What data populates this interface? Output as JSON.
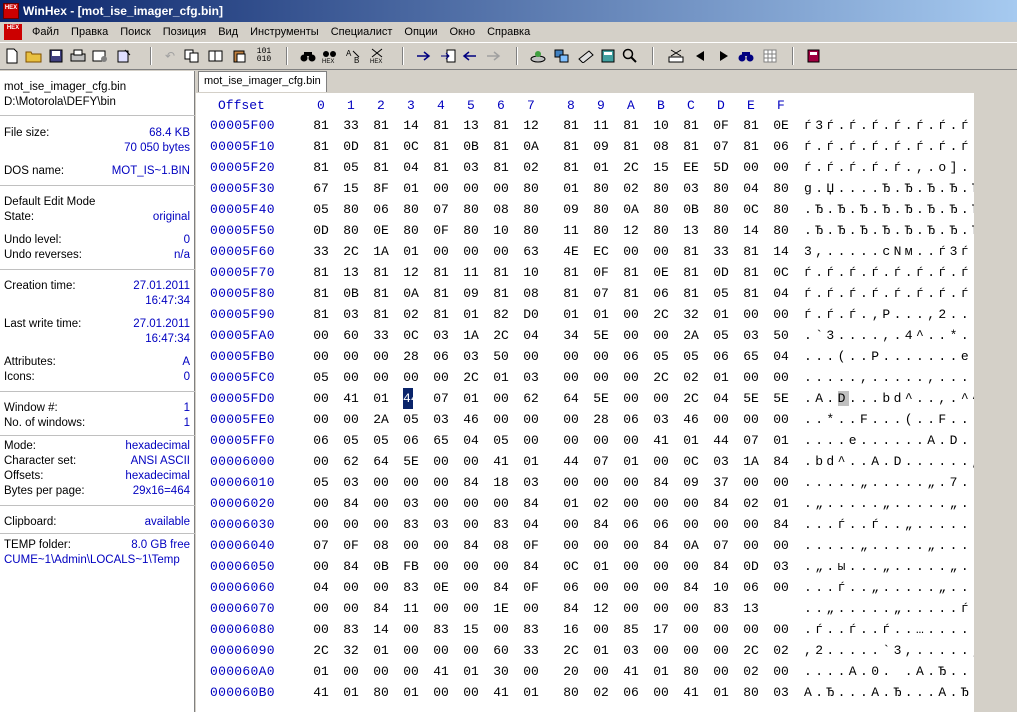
{
  "window": {
    "title": "WinHex - [mot_ise_imager_cfg.bin]",
    "app_icon_text": "HEX"
  },
  "menu": [
    "Файл",
    "Правка",
    "Поиск",
    "Позиция",
    "Вид",
    "Инструменты",
    "Специалист",
    "Опции",
    "Окно",
    "Справка"
  ],
  "toolbar_icons": [
    "new-file-icon",
    "open-folder-icon",
    "save-icon",
    "print-icon",
    "properties-icon",
    "undo-icon",
    "copy-icon",
    "copy-block-icon",
    "paste-icon",
    "binary-convert-icon",
    "find-icon",
    "find-hex-icon",
    "replace-icon",
    "replace-hex-icon",
    "goto-offset-icon",
    "goto-page-icon",
    "back-icon",
    "forward-icon",
    "disk-icon",
    "ram-icon",
    "data-interpreter-icon",
    "calculator-icon",
    "search-text-icon",
    "clone-icon",
    "arrow-left-icon",
    "arrow-right-icon",
    "search-blue-icon",
    "table-icon",
    "book-icon"
  ],
  "tab": {
    "label": "mot_ise_imager_cfg.bin"
  },
  "sidebar": {
    "filename": "mot_ise_imager_cfg.bin",
    "path": "D:\\Motorola\\DEFY\\bin",
    "file_size_label": "File size:",
    "file_size_kb": "68.4 KB",
    "file_size_bytes": "70 050 bytes",
    "dos_name_label": "DOS name:",
    "dos_name": "MOT_IS~1.BIN",
    "edit_mode": "Default Edit Mode",
    "state_label": "State:",
    "state": "original",
    "undo_level_label": "Undo level:",
    "undo_level": "0",
    "undo_reverses_label": "Undo reverses:",
    "undo_reverses": "n/a",
    "creation_label": "Creation time:",
    "creation_date": "27.01.2011",
    "creation_time": "16:47:34",
    "lastwrite_label": "Last write time:",
    "lastwrite_date": "27.01.2011",
    "lastwrite_time": "16:47:34",
    "attributes_label": "Attributes:",
    "attributes": "A",
    "icons_label": "Icons:",
    "icons": "0",
    "window_num_label": "Window #:",
    "window_num": "1",
    "num_windows_label": "No. of windows:",
    "num_windows": "1",
    "mode_label": "Mode:",
    "mode": "hexadecimal",
    "charset_label": "Character set:",
    "charset": "ANSI ASCII",
    "offsets_label": "Offsets:",
    "offsets": "hexadecimal",
    "bpp_label": "Bytes per page:",
    "bpp": "29x16=464",
    "clipboard_label": "Clipboard:",
    "clipboard": "available",
    "temp_label": "TEMP folder:",
    "temp_free": "8.0 GB free",
    "temp_path": "CUME~1\\Admin\\LOCALS~1\\Temp"
  },
  "hex_view": {
    "offset_header": "Offset",
    "column_headers": [
      "0",
      "1",
      "2",
      "3",
      "4",
      "5",
      "6",
      "7",
      "8",
      "9",
      "A",
      "B",
      "C",
      "D",
      "E",
      "F"
    ],
    "selected_offset": "00005FD3",
    "rows": [
      {
        "offset": "00005F00",
        "bytes": [
          "81",
          "33",
          "81",
          "14",
          "81",
          "13",
          "81",
          "12",
          "81",
          "11",
          "81",
          "10",
          "81",
          "0F",
          "81",
          "0E"
        ],
        "text": "ѓ3ѓ.ѓ.ѓ.ѓ.ѓ.ѓ.ѓ."
      },
      {
        "offset": "00005F10",
        "bytes": [
          "81",
          "0D",
          "81",
          "0C",
          "81",
          "0B",
          "81",
          "0A",
          "81",
          "09",
          "81",
          "08",
          "81",
          "07",
          "81",
          "06"
        ],
        "text": "ѓ.ѓ.ѓ.ѓ.ѓ.ѓ.ѓ.ѓ."
      },
      {
        "offset": "00005F20",
        "bytes": [
          "81",
          "05",
          "81",
          "04",
          "81",
          "03",
          "81",
          "02",
          "81",
          "01",
          "2C",
          "15",
          "EE",
          "5D",
          "00",
          "00"
        ],
        "text": "ѓ.ѓ.ѓ.ѓ.ѓ.,.o]..",
        "text_display": "ѓ.ѓ.ѓ.ѓ.ѓ.,.о].."
      },
      {
        "offset": "00005F30",
        "bytes": [
          "67",
          "15",
          "8F",
          "01",
          "00",
          "00",
          "00",
          "80",
          "01",
          "80",
          "02",
          "80",
          "03",
          "80",
          "04",
          "80"
        ],
        "text": "g.Џ....Ђ.Ђ.Ђ.Ђ.Ђ"
      },
      {
        "offset": "00005F40",
        "bytes": [
          "05",
          "80",
          "06",
          "80",
          "07",
          "80",
          "08",
          "80",
          "09",
          "80",
          "0A",
          "80",
          "0B",
          "80",
          "0C",
          "80"
        ],
        "text": ".Ђ.Ђ.Ђ.Ђ.Ђ.Ђ.Ђ.Ђ"
      },
      {
        "offset": "00005F50",
        "bytes": [
          "0D",
          "80",
          "0E",
          "80",
          "0F",
          "80",
          "10",
          "80",
          "11",
          "80",
          "12",
          "80",
          "13",
          "80",
          "14",
          "80"
        ],
        "text": ".Ђ.Ђ.Ђ.Ђ.Ђ.Ђ.Ђ.Ђ"
      },
      {
        "offset": "00005F60",
        "bytes": [
          "33",
          "2C",
          "1A",
          "01",
          "00",
          "00",
          "00",
          "63",
          "4E",
          "EC",
          "00",
          "00",
          "81",
          "33",
          "81",
          "14"
        ],
        "text": "3,.....cNм..ѓ3ѓ."
      },
      {
        "offset": "00005F70",
        "bytes": [
          "81",
          "13",
          "81",
          "12",
          "81",
          "11",
          "81",
          "10",
          "81",
          "0F",
          "81",
          "0E",
          "81",
          "0D",
          "81",
          "0C"
        ],
        "text": "ѓ.ѓ.ѓ.ѓ.ѓ.ѓ.ѓ.ѓ."
      },
      {
        "offset": "00005F80",
        "bytes": [
          "81",
          "0B",
          "81",
          "0A",
          "81",
          "09",
          "81",
          "08",
          "81",
          "07",
          "81",
          "06",
          "81",
          "05",
          "81",
          "04"
        ],
        "text": "ѓ.ѓ.ѓ.ѓ.ѓ.ѓ.ѓ.ѓ."
      },
      {
        "offset": "00005F90",
        "bytes": [
          "81",
          "03",
          "81",
          "02",
          "81",
          "01",
          "82",
          "D0",
          "01",
          "01",
          "00",
          "2C",
          "32",
          "01",
          "00",
          "00"
        ],
        "text": "ѓ.ѓ.ѓ.‚Р...,2..."
      },
      {
        "offset": "00005FA0",
        "bytes": [
          "00",
          "60",
          "33",
          "0C",
          "03",
          "1A",
          "2C",
          "04",
          "34",
          "5E",
          "00",
          "00",
          "2A",
          "05",
          "03",
          "50"
        ],
        "text": ".`3....,.4^..*..P"
      },
      {
        "offset": "00005FB0",
        "bytes": [
          "00",
          "00",
          "00",
          "28",
          "06",
          "03",
          "50",
          "00",
          "00",
          "00",
          "06",
          "05",
          "05",
          "06",
          "65",
          "04"
        ],
        "text": "...(..P.......e."
      },
      {
        "offset": "00005FC0",
        "bytes": [
          "05",
          "00",
          "00",
          "00",
          "00",
          "2C",
          "01",
          "03",
          "00",
          "00",
          "00",
          "2C",
          "02",
          "01",
          "00",
          "00"
        ],
        "text": ".....,.....,...."
      },
      {
        "offset": "00005FD0",
        "bytes": [
          "00",
          "41",
          "01",
          "44",
          "07",
          "01",
          "00",
          "62",
          "64",
          "5E",
          "00",
          "00",
          "2C",
          "04",
          "5E",
          "5E"
        ],
        "text": ".A.D...bd^..,.^^"
      },
      {
        "offset": "00005FE0",
        "bytes": [
          "00",
          "00",
          "2A",
          "05",
          "03",
          "46",
          "00",
          "00",
          "00",
          "28",
          "06",
          "03",
          "46",
          "00",
          "00",
          "00"
        ],
        "text": "..*..F...(..F..."
      },
      {
        "offset": "00005FF0",
        "bytes": [
          "06",
          "05",
          "05",
          "06",
          "65",
          "04",
          "05",
          "00",
          "00",
          "00",
          "00",
          "41",
          "01",
          "44",
          "07",
          "01"
        ],
        "text": "....e......A.D.."
      },
      {
        "offset": "00006000",
        "bytes": [
          "00",
          "62",
          "64",
          "5E",
          "00",
          "00",
          "41",
          "01",
          "44",
          "07",
          "01",
          "00",
          "0C",
          "03",
          "1A",
          "84"
        ],
        "text": ".bd^..A.D......„"
      },
      {
        "offset": "00006010",
        "bytes": [
          "05",
          "03",
          "00",
          "00",
          "00",
          "84",
          "18",
          "03",
          "00",
          "00",
          "00",
          "84",
          "09",
          "37",
          "00",
          "00"
        ],
        "text": ".....„.....„.7.."
      },
      {
        "offset": "00006020",
        "bytes": [
          "00",
          "84",
          "00",
          "03",
          "00",
          "00",
          "00",
          "84",
          "01",
          "02",
          "00",
          "00",
          "00",
          "84",
          "02",
          "01"
        ],
        "text": ".„.....„.....„.."
      },
      {
        "offset": "00006030",
        "bytes": [
          "00",
          "00",
          "00",
          "83",
          "03",
          "00",
          "83",
          "04",
          "00",
          "84",
          "06",
          "06",
          "00",
          "00",
          "00",
          "84"
        ],
        "text": "...ѓ..ѓ..„......„"
      },
      {
        "offset": "00006040",
        "bytes": [
          "07",
          "0F",
          "08",
          "00",
          "00",
          "84",
          "08",
          "0F",
          "00",
          "00",
          "00",
          "84",
          "0A",
          "07",
          "00",
          "00"
        ],
        "text": ".....„.....„...."
      },
      {
        "offset": "00006050",
        "bytes": [
          "00",
          "84",
          "0B",
          "FB",
          "00",
          "00",
          "00",
          "84",
          "0C",
          "01",
          "00",
          "00",
          "00",
          "84",
          "0D",
          "03"
        ],
        "text": ".„.ы...„.....„.."
      },
      {
        "offset": "00006060",
        "bytes": [
          "04",
          "00",
          "00",
          "83",
          "0E",
          "00",
          "84",
          "0F",
          "06",
          "00",
          "00",
          "00",
          "84",
          "10",
          "06",
          "00"
        ],
        "text": "...ѓ..„.....„..."
      },
      {
        "offset": "00006070",
        "bytes": [
          "00",
          "00",
          "84",
          "11",
          "00",
          "00",
          "1E",
          "00",
          "84",
          "12",
          "00",
          "00",
          "00",
          "83",
          "13"
        ],
        "text": "..„.....„.....ѓ."
      },
      {
        "offset": "00006080",
        "bytes": [
          "00",
          "83",
          "14",
          "00",
          "83",
          "15",
          "00",
          "83",
          "16",
          "00",
          "85",
          "17",
          "00",
          "00",
          "00",
          "00"
        ],
        "text": ".ѓ..ѓ..ѓ..…....."
      },
      {
        "offset": "00006090",
        "bytes": [
          "2C",
          "32",
          "01",
          "00",
          "00",
          "00",
          "60",
          "33",
          "2C",
          "01",
          "03",
          "00",
          "00",
          "00",
          "2C",
          "02"
        ],
        "text": ",2.....`3,.....,."
      },
      {
        "offset": "000060A0",
        "bytes": [
          "01",
          "00",
          "00",
          "00",
          "41",
          "01",
          "30",
          "00",
          "20",
          "00",
          "41",
          "01",
          "80",
          "00",
          "02",
          "00"
        ],
        "text": "....A.0. .A.Ђ..."
      },
      {
        "offset": "000060B0",
        "bytes": [
          "41",
          "01",
          "80",
          "01",
          "00",
          "00",
          "41",
          "01",
          "80",
          "02",
          "06",
          "00",
          "41",
          "01",
          "80",
          "03"
        ],
        "text": "A.Ђ...A.Ђ...A.Ђ."
      }
    ]
  }
}
